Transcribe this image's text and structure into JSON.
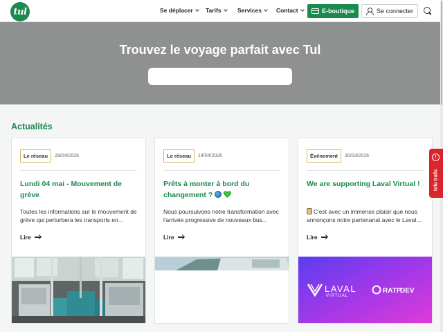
{
  "header": {
    "logo_text": "tul",
    "nav": [
      {
        "label": "Se déplacer",
        "icon": "chevron-down-icon"
      },
      {
        "label": "Tarifs",
        "icon": "chevron-down-icon"
      },
      {
        "label": "Services",
        "icon": "chevron-down-icon"
      },
      {
        "label": "Contact",
        "icon": "chevron-down-icon"
      }
    ],
    "eboutique_label": "E-boutique",
    "login_label": "Se connecter"
  },
  "hero": {
    "title": "Trouvez le voyage parfait avec Tul",
    "search_value": "",
    "background_color": "#8f9090"
  },
  "news": {
    "title": "Actualités",
    "cards": [
      {
        "tag": "Le réseau",
        "date": "29/04/2026",
        "title": "Lundi 04 mai - Mouvement de grève",
        "description": "Toutes les informations sur le mouvement de grève qui perturbera les transports en...",
        "read_label": "Lire",
        "image": "bus-interior-photo"
      },
      {
        "tag": "Le réseau",
        "date": "14/04/2026",
        "title": "Prêts à monter à bord du changement ?",
        "title_emojis": [
          "globe-icon",
          "green-heart-icon"
        ],
        "description": "Nous poursuivons notre transformation avec l'arrivée progressive de nouveaux bus...",
        "read_label": "Lire",
        "image": "new-bus-photo"
      },
      {
        "tag": "Événement",
        "date": "30/03/2026",
        "title": "We are supporting Laval Virtual !",
        "description_emoji": "bus-icon",
        "description": "C'est avec un immense plaisir que nous annonçons notre partenariat avec le Laval...",
        "read_label": "Lire",
        "image_logos": {
          "laval_main": "LAVAL",
          "laval_sub": "VIRTUAL",
          "ratp_main": "RATP",
          "ratp_sub": "DEV"
        }
      }
    ]
  },
  "traffic_tab": {
    "label": "Info trafic",
    "icon_glyph": "!"
  },
  "colors": {
    "brand_green": "#1a8a4f",
    "tag_border": "#d6b46a",
    "traffic_red": "#d8262c"
  }
}
